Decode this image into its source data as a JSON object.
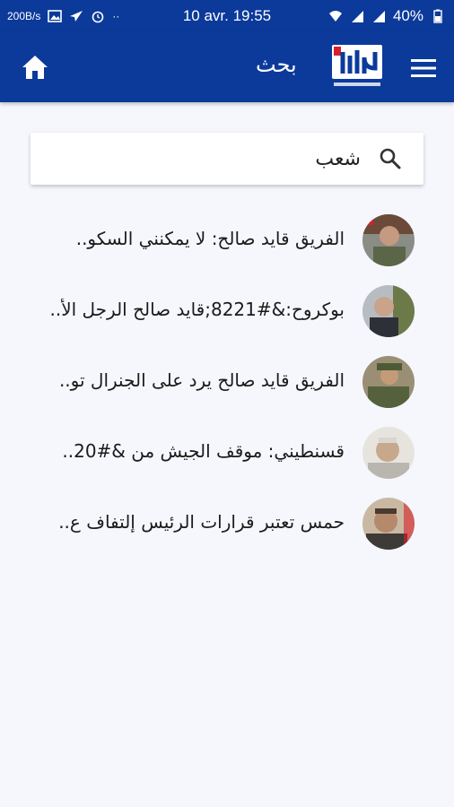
{
  "status_bar": {
    "net_speed": "200B/s",
    "time": "10 avr. 19:55",
    "battery": "40%"
  },
  "app_bar": {
    "title": "بحث",
    "logo_text": "الحوار"
  },
  "search": {
    "value": "شعب"
  },
  "results": [
    {
      "title": "الفريق قايد صالح: لا يمكنني السكو.."
    },
    {
      "title": "بوكروح:&#8221;قايد صالح الرجل الأ.."
    },
    {
      "title": "الفريق قايد صالح يرد على الجنرال تو.."
    },
    {
      "title": "قسنطيني: موقف الجيش من &#20.."
    },
    {
      "title": "حمس تعتبر قرارات الرئيس إلتفاف ع.."
    }
  ],
  "colors": {
    "primary": "#0b3a9b",
    "background": "#f5f7fd",
    "logo_accent": "#d81f2a"
  }
}
